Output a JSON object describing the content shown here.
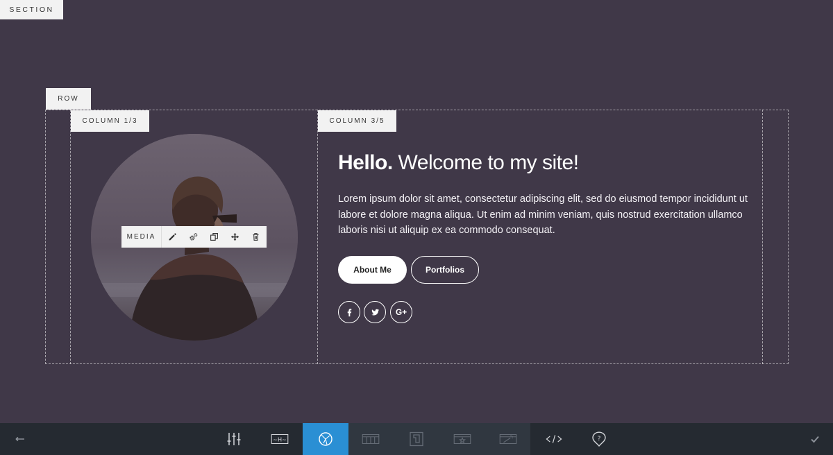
{
  "labels": {
    "section": "SECTION",
    "row": "ROW",
    "column_left": "COLUMN 1/3",
    "column_right": "COLUMN 3/5",
    "media": "MEDIA"
  },
  "hero": {
    "title_bold": "Hello.",
    "title_rest": " Welcome to my site!",
    "body": "Lorem ipsum dolor sit amet, consectetur adipiscing elit, sed do eiusmod tempor incididunt ut labore et dolore magna aliqua. Ut enim ad minim veniam, quis nostrud exercitation ullamco laboris nisi ut aliquip ex ea commodo consequat.",
    "buttons": {
      "about": "About Me",
      "portfolios": "Portfolios"
    },
    "social": {
      "facebook": "f",
      "twitter": "twitter-icon",
      "google": "G+"
    }
  },
  "toolbar_icons": [
    "edit-icon",
    "settings-icon",
    "duplicate-icon",
    "move-icon",
    "delete-icon"
  ],
  "bottombar_icons": [
    "back-arrow-icon",
    "sliders-icon",
    "heading-icon",
    "design-icon",
    "columns-icon",
    "layout-icon",
    "featured-icon",
    "wand-icon",
    "code-icon",
    "help-icon",
    "check-icon"
  ],
  "colors": {
    "background": "#403848",
    "bar": "#252a31",
    "accent": "#2a8fd4"
  }
}
